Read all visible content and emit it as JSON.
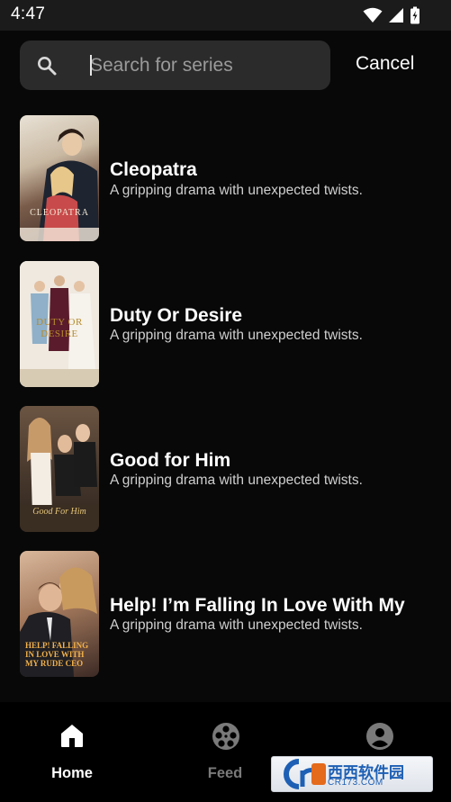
{
  "status_bar": {
    "time": "4:47",
    "icons": [
      "wifi-icon",
      "cell-signal-icon",
      "battery-charging-icon"
    ]
  },
  "search": {
    "placeholder": "Search for series",
    "value": "",
    "cancel_label": "Cancel"
  },
  "results": [
    {
      "title": "Cleopatra",
      "description": "A gripping drama with unexpected twists.",
      "poster_caption": "CLEOPATRA"
    },
    {
      "title": "Duty Or Desire",
      "description": "A gripping drama with unexpected twists.",
      "poster_caption": "DUTY OR DESIRE"
    },
    {
      "title": "Good for Him",
      "description": "A gripping drama with unexpected twists.",
      "poster_caption": "Good For Him"
    },
    {
      "title": "Help! I’m Falling In Love With My",
      "description": "A gripping drama with unexpected twists.",
      "poster_caption": "HELP! FALLING IN LOVE WITH MY RUDE CEO"
    }
  ],
  "bottom_nav": {
    "items": [
      {
        "label": "Home",
        "icon": "home-icon",
        "active": true
      },
      {
        "label": "Feed",
        "icon": "film-reel-icon",
        "active": false
      },
      {
        "label": "",
        "icon": "profile-icon",
        "active": false
      }
    ]
  },
  "watermark": {
    "text": "西西软件园",
    "sub": "CR173.COM"
  },
  "colors": {
    "background": "#080808",
    "search_box": "#2b2b2b",
    "nav_active": "#ffffff",
    "nav_inactive": "#7a7a7a"
  }
}
